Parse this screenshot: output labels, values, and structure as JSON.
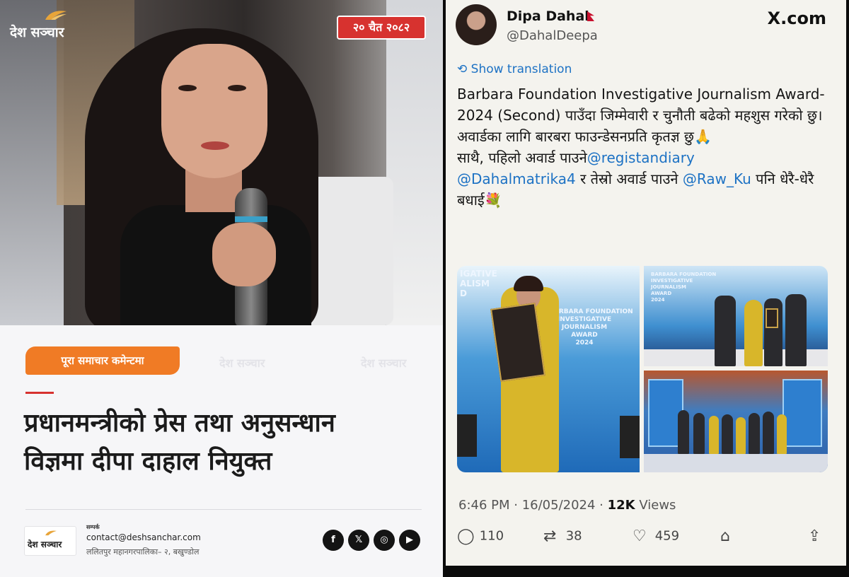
{
  "left": {
    "logo_text": "देश सञ्चार",
    "date": "२० चैत २०८२",
    "tag": "पूरा समाचार कमेन्टमा",
    "watermarks": [
      "देश सञ्चार",
      "देश सञ्चार"
    ],
    "headline_line1": "प्रधानमन्त्रीको प्रेस तथा अनुसन्धान",
    "headline_line2": "विज्ञमा दीपा दाहाल नियुक्त",
    "footer_logo_text": "देश सञ्चार",
    "contact_label": "सम्पर्क",
    "contact_email": "contact@deshsanchar.com",
    "contact_address": "ललितपुर महानगरपालिका– २, बखुण्डोल",
    "social": [
      {
        "icon": "facebook-icon",
        "glyph": "f"
      },
      {
        "icon": "x-icon",
        "glyph": "𝕏"
      },
      {
        "icon": "instagram-icon",
        "glyph": "◎"
      },
      {
        "icon": "youtube-icon",
        "glyph": "▶"
      }
    ],
    "colors": {
      "accent": "#f07b25",
      "badge": "#d7322f"
    }
  },
  "tweet": {
    "name": "Dipa Dahal",
    "handle": "@DahalDeepa",
    "site": "X.com",
    "show_translation": "Show translation",
    "text_1": "Barbara Foundation Investigative Journalism Award-2024 (Second) पाउँदा जिम्मेवारी र चुनौती बढेको महशुस गरेको छु। अवार्डका लागि  बारबरा फाउन्डेसनप्रति कृतज्ञ छु🙏",
    "text_2a": "साथै, पहिलो अवार्ड पाउने",
    "mention_1": "@registandiary",
    "mention_2": "@Dahalmatrika4",
    "text_2b": " र तेस्रो अवार्ड  पाउने ",
    "mention_3": "@Raw_Ku",
    "text_2c": "  पनि धेरै-धेरै बधाई💐",
    "image_text_main": "IGATIVE\nALISM\nD",
    "image_text_award": "BARBARA FOUNDATION\nINVESTIGATIVE\nJOURNALISM\nAWARD\n2024",
    "image_text_tr": "BARBARA FOUNDATION\nINVESTIGATIVE\nJOURNALISM\nAWARD\n2024",
    "time": "6:46 PM · 16/05/2024 · ",
    "views_count": "12K",
    "views_label": " Views",
    "replies": "110",
    "reposts": "38",
    "likes": "459",
    "colors": {
      "link": "#1d72c4"
    }
  }
}
